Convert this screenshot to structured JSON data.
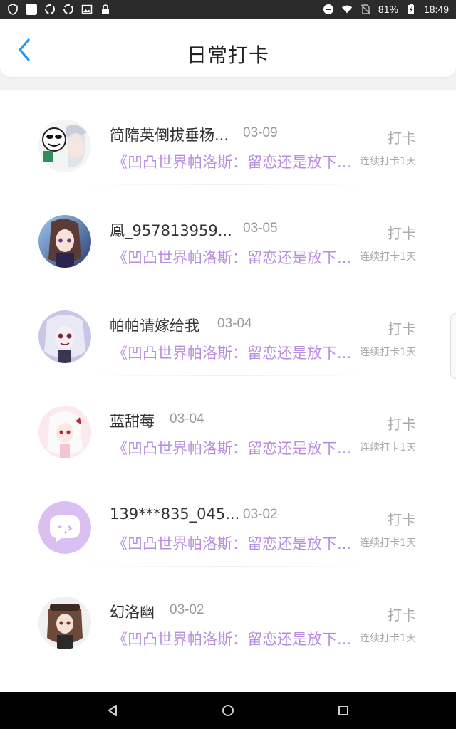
{
  "status_bar": {
    "battery": "81%",
    "time": "18:49",
    "left_icons": [
      "shield-icon",
      "square-icon",
      "sync-icon",
      "sync-icon",
      "image-icon",
      "lock-icon"
    ],
    "right_icons": [
      "dnd-icon",
      "wifi-icon",
      "no-sim-icon",
      "battery-charging-icon"
    ]
  },
  "header": {
    "title": "日常打卡",
    "back_icon": "chevron-left-icon"
  },
  "items": [
    {
      "name": "简隋英倒拔垂杨...",
      "date": "03-09",
      "post": "《凹凸世界帕洛斯：留恋还是放下...",
      "checkin_label": "打卡",
      "streak": "连续打卡1天",
      "avatar_style": "meme"
    },
    {
      "name": "鳳_957813959...",
      "date": "03-05",
      "post": "《凹凸世界帕洛斯：留恋还是放下...",
      "checkin_label": "打卡",
      "streak": "连续打卡1天",
      "avatar_style": "anime-blue"
    },
    {
      "name": "帕帕请嫁给我",
      "date": "03-04",
      "post": "《凹凸世界帕洛斯：留恋还是放下...",
      "checkin_label": "打卡",
      "streak": "连续打卡1天",
      "avatar_style": "anime-purple"
    },
    {
      "name": "蓝甜莓",
      "date": "03-04",
      "post": "《凹凸世界帕洛斯：留恋还是放下...",
      "checkin_label": "打卡",
      "streak": "连续打卡1天",
      "avatar_style": "anime-pink"
    },
    {
      "name": "139***835_045...",
      "date": "03-02",
      "post": "《凹凸世界帕洛斯：留恋还是放下...",
      "checkin_label": "打卡",
      "streak": "连续打卡1天",
      "avatar_style": "default-chat"
    },
    {
      "name": "幻洛幽",
      "date": "03-02",
      "post": "《凹凸世界帕洛斯：留恋还是放下...",
      "checkin_label": "打卡",
      "streak": "连续打卡1天",
      "avatar_style": "anime-brown"
    }
  ],
  "nav_bar": {
    "buttons": [
      "back-triangle-icon",
      "home-circle-icon",
      "recents-square-icon"
    ]
  },
  "colors": {
    "accent_blue": "#2196f3",
    "post_purple": "#b98ee0",
    "default_avatar_bg": "#d9bff2"
  }
}
